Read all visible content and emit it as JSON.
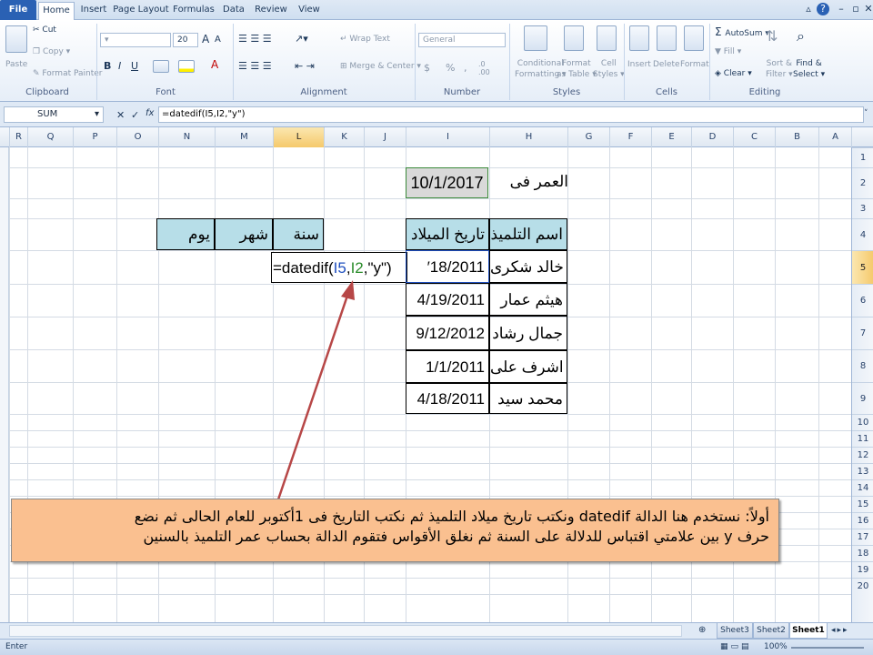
{
  "tabs": [
    "File",
    "Home",
    "Insert",
    "Page Layout",
    "Formulas",
    "Data",
    "Review",
    "View"
  ],
  "ribbon": {
    "clipboard": {
      "paste": "Paste",
      "cut": "Cut",
      "copy": "Copy",
      "format_painter": "Format Painter",
      "label": "Clipboard"
    },
    "font": {
      "size": "20",
      "label": "Font",
      "bold": "B",
      "italic": "I",
      "underline": "U",
      "grow": "A",
      "shrink": "A"
    },
    "alignment": {
      "wrap": "Wrap Text",
      "merge": "Merge & Center",
      "label": "Alignment"
    },
    "number": {
      "format": "General",
      "label": "Number",
      "currency": "$",
      "percent": "%",
      "comma": ","
    },
    "styles": {
      "conditional": "Conditional",
      "conditional2": "Formatting",
      "format_table": "Format",
      "format_table2": "as Table",
      "cell_styles": "Cell",
      "cell_styles2": "Styles",
      "label": "Styles"
    },
    "cells": {
      "insert": "Insert",
      "delete": "Delete",
      "format": "Format",
      "label": "Cells"
    },
    "editing": {
      "autosum": "AutoSum",
      "fill": "Fill",
      "clear": "Clear",
      "sort": "Sort &",
      "sort2": "Filter",
      "find": "Find &",
      "find2": "Select",
      "label": "Editing"
    }
  },
  "formula_bar": {
    "name_box": "SUM",
    "cancel": "✕",
    "enter": "✓",
    "fx": "fx",
    "formula": "=datedif(I5,I2,\"y\")"
  },
  "columns": [
    "R",
    "Q",
    "P",
    "O",
    "N",
    "M",
    "L",
    "K",
    "J",
    "I",
    "H",
    "G",
    "F",
    "E",
    "D",
    "C",
    "B",
    "A"
  ],
  "rows": [
    "1",
    "2",
    "3",
    "4",
    "5",
    "6",
    "7",
    "8",
    "9",
    "10",
    "11",
    "12",
    "13",
    "14",
    "15",
    "16",
    "17",
    "18",
    "19",
    "20"
  ],
  "cells": {
    "age_label": "العمر فى",
    "reference_date": "10/1/2017",
    "student_header": "اسم التلميذ",
    "birth_header": "تاريخ الميلاد",
    "year_header": "سنة",
    "month_header": "شهر",
    "day_header": "يوم",
    "editing_formula": "=datedif(I5,I2,\"y\")",
    "students": [
      {
        "name": "خالد شكرى",
        "birth": "′18/2011"
      },
      {
        "name": "هيثم عمار",
        "birth": "4/19/2011"
      },
      {
        "name": "جمال رشاد",
        "birth": "9/12/2012"
      },
      {
        "name": "اشرف على",
        "birth": "1/1/2011"
      },
      {
        "name": "محمد سيد",
        "birth": "4/18/2011"
      }
    ]
  },
  "callout": {
    "line1": "أولاً: نستخدم هنا الدالة datedif  ونكتب تاريخ ميلاد التلميذ ثم نكتب التاريخ فى 1أكتوبر للعام الحالى ثم نضع",
    "line2": "حرف y بين علامتي اقتباس للدلالة على السنة ثم نغلق الأقواس فتقوم الدالة بحساب عمر التلميذ بالسنين"
  },
  "sheets": [
    "Sheet3",
    "Sheet2",
    "Sheet1"
  ],
  "status": {
    "mode": "Enter",
    "zoom": "100%"
  }
}
